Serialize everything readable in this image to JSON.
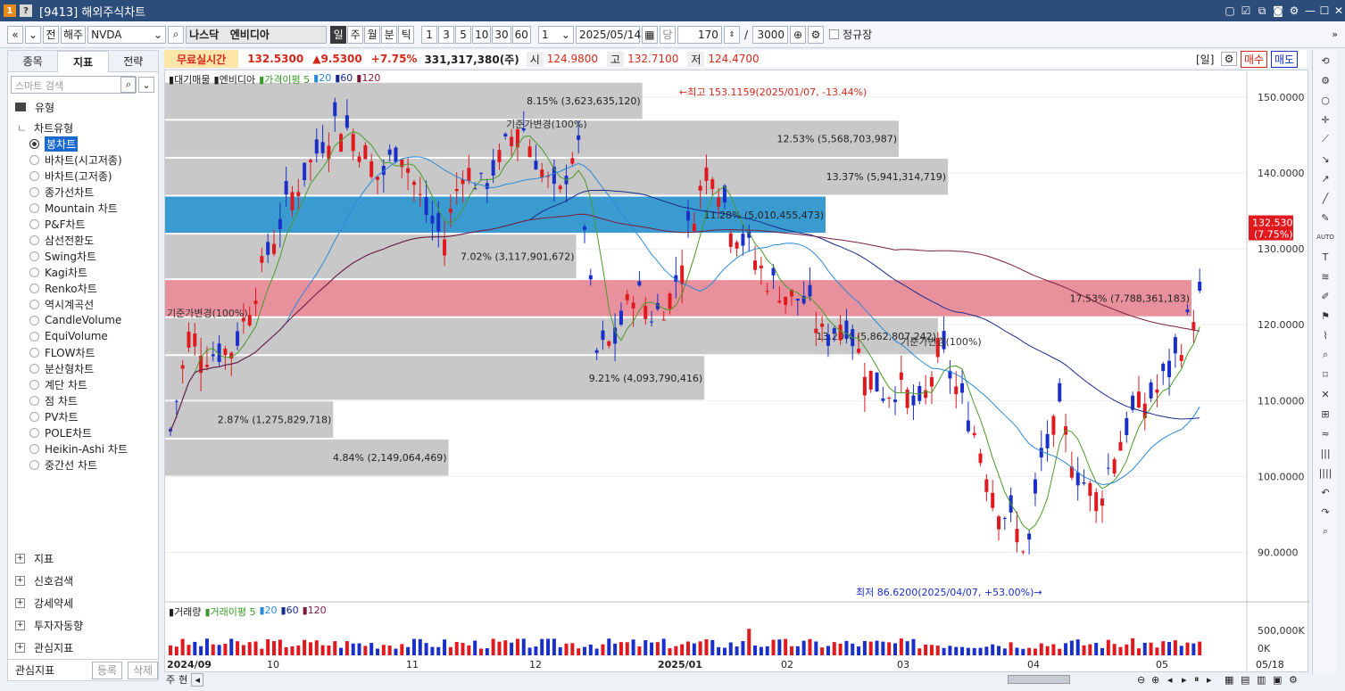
{
  "window": {
    "title": "[9413] 해외주식차트",
    "icon1": "1",
    "icon2": "?"
  },
  "toolbar": {
    "nav_prev": "«",
    "nav_down": "»",
    "front": "전",
    "market": "해주",
    "symbol": "NVDA",
    "exchange_name": "나스닥",
    "stock_name": "엔비디아",
    "periods": [
      {
        "label": "일",
        "sel": true
      },
      {
        "label": "주",
        "sel": false
      },
      {
        "label": "월",
        "sel": false
      },
      {
        "label": "분",
        "sel": false
      },
      {
        "label": "틱",
        "sel": false
      }
    ],
    "intervals": [
      "1",
      "3",
      "5",
      "10",
      "30",
      "60"
    ],
    "unit_count": "1",
    "date": "2025/05/14",
    "today": "당",
    "count": "170",
    "sep": "/",
    "max_count": "3000",
    "regular": "정규장"
  },
  "sidebar": {
    "tabs": [
      {
        "label": "종목",
        "sel": false
      },
      {
        "label": "지표",
        "sel": true
      },
      {
        "label": "전략",
        "sel": false
      }
    ],
    "search_placeholder": "스마트 검색",
    "type_group": "유형",
    "chart_type_group": "차트유형",
    "chart_types": [
      "봉차트",
      "바차트(시고저종)",
      "바차트(고저종)",
      "종가선차트",
      "Mountain 차트",
      "P&F차트",
      "삼선전환도",
      "Swing차트",
      "Kagi차트",
      "Renko차트",
      "역시계곡선",
      "CandleVolume",
      "EquiVolume",
      "FLOW차트",
      "분산형차트",
      "계단 차트",
      "점 차트",
      "PV차트",
      "POLE차트",
      "Heikin-Ashi 차트",
      "중간선 차트"
    ],
    "selected_type": 0,
    "groups": [
      "지표",
      "신호검색",
      "강세약세",
      "투자자동향",
      "관심지표"
    ],
    "footer_label": "관심지표",
    "register": "등록",
    "delete": "삭제"
  },
  "info": {
    "realtime": "무료실시간",
    "price": "132.5300",
    "change": "▲9.5300",
    "pct": "+7.75%",
    "volume": "331,317,380(주)",
    "open_label": "시",
    "open": "124.9800",
    "high_label": "고",
    "high": "132.7100",
    "low_label": "저",
    "low": "124.4700",
    "period_label": "[일]",
    "buy": "매수",
    "sell": "매도"
  },
  "legend": {
    "items": [
      {
        "text": "대기매물",
        "color": "#222"
      },
      {
        "text": "엔비디아",
        "color": "#222"
      },
      {
        "text": "가격이평 5",
        "color": "#3a9a2a"
      },
      {
        "text": "20",
        "color": "#2a8ad8"
      },
      {
        "text": "60",
        "color": "#1a2a8a"
      },
      {
        "text": "120",
        "color": "#7a1a3a"
      }
    ]
  },
  "vol_legend": {
    "items": [
      {
        "text": "거래량",
        "color": "#222"
      },
      {
        "text": "거래이평 5",
        "color": "#3a9a2a"
      },
      {
        "text": "20",
        "color": "#2a8ad8"
      },
      {
        "text": "60",
        "color": "#1a2a8a"
      },
      {
        "text": "120",
        "color": "#7a1a3a"
      }
    ]
  },
  "colors": {
    "up": "#e0191f",
    "down": "#1a2fc8",
    "ma5": "#4a9a2a",
    "ma20": "#2a8ad8",
    "ma60": "#1a2a8a",
    "ma120": "#7a2040",
    "box_gray": "#c8c8c8",
    "box_blue": "#3a9bd0",
    "box_red": "#e8909c"
  },
  "chart_data": {
    "type": "candlestick",
    "y_ticks": [
      "150.0000",
      "140.0000",
      "130.0000",
      "120.0000",
      "110.0000",
      "100.0000",
      "90.0000"
    ],
    "y_range": [
      83.5,
      153.5
    ],
    "last_price_tag": "132.5300",
    "last_pct_tag": "(7.75%)",
    "x_labels": [
      "2024/09",
      "10",
      "11",
      "12",
      "2025/01",
      "02",
      "03",
      "04",
      "05",
      "05/18"
    ],
    "vol_ticks": [
      "500,000K",
      "0K"
    ],
    "max_annotation": "←최고 153.1159(2025/01/07, -13.44%)",
    "min_annotation": "최저 86.6200(2025/04/07, +53.00%)→",
    "base_annotations": [
      "기준가변경(100%)",
      "기준가변경(100%)",
      "기준가변경(100%)"
    ],
    "volume_profile": [
      {
        "range": [
          147,
          152
        ],
        "label": "8.15% (3,623,635,120)",
        "pct": 8.15
      },
      {
        "range": [
          142,
          147
        ],
        "label": "12.53% (5,568,703,987)",
        "pct": 12.53
      },
      {
        "range": [
          137,
          142
        ],
        "label": "13.37% (5,941,314,719)",
        "pct": 13.37
      },
      {
        "range": [
          132,
          137
        ],
        "label": "11.28% (5,010,455,473)",
        "pct": 11.28
      },
      {
        "range": [
          126,
          132
        ],
        "label": "7.02% (3,117,901,672)",
        "pct": 7.02
      },
      {
        "range": [
          121,
          126
        ],
        "label": "17.53% (7,788,361,183)",
        "pct": 17.53
      },
      {
        "range": [
          116,
          121
        ],
        "label": "13.20% (5,862,807,242)",
        "pct": 13.2
      },
      {
        "range": [
          110,
          116
        ],
        "label": "9.21% (4,093,790,416)",
        "pct": 9.21
      },
      {
        "range": [
          105,
          110
        ],
        "label": "2.87% (1,275,829,718)",
        "pct": 2.87
      },
      {
        "range": [
          100,
          105
        ],
        "label": "4.84% (2,149,064,469)",
        "pct": 4.84
      }
    ]
  },
  "bottom": {
    "a": "주",
    "b": "현"
  }
}
